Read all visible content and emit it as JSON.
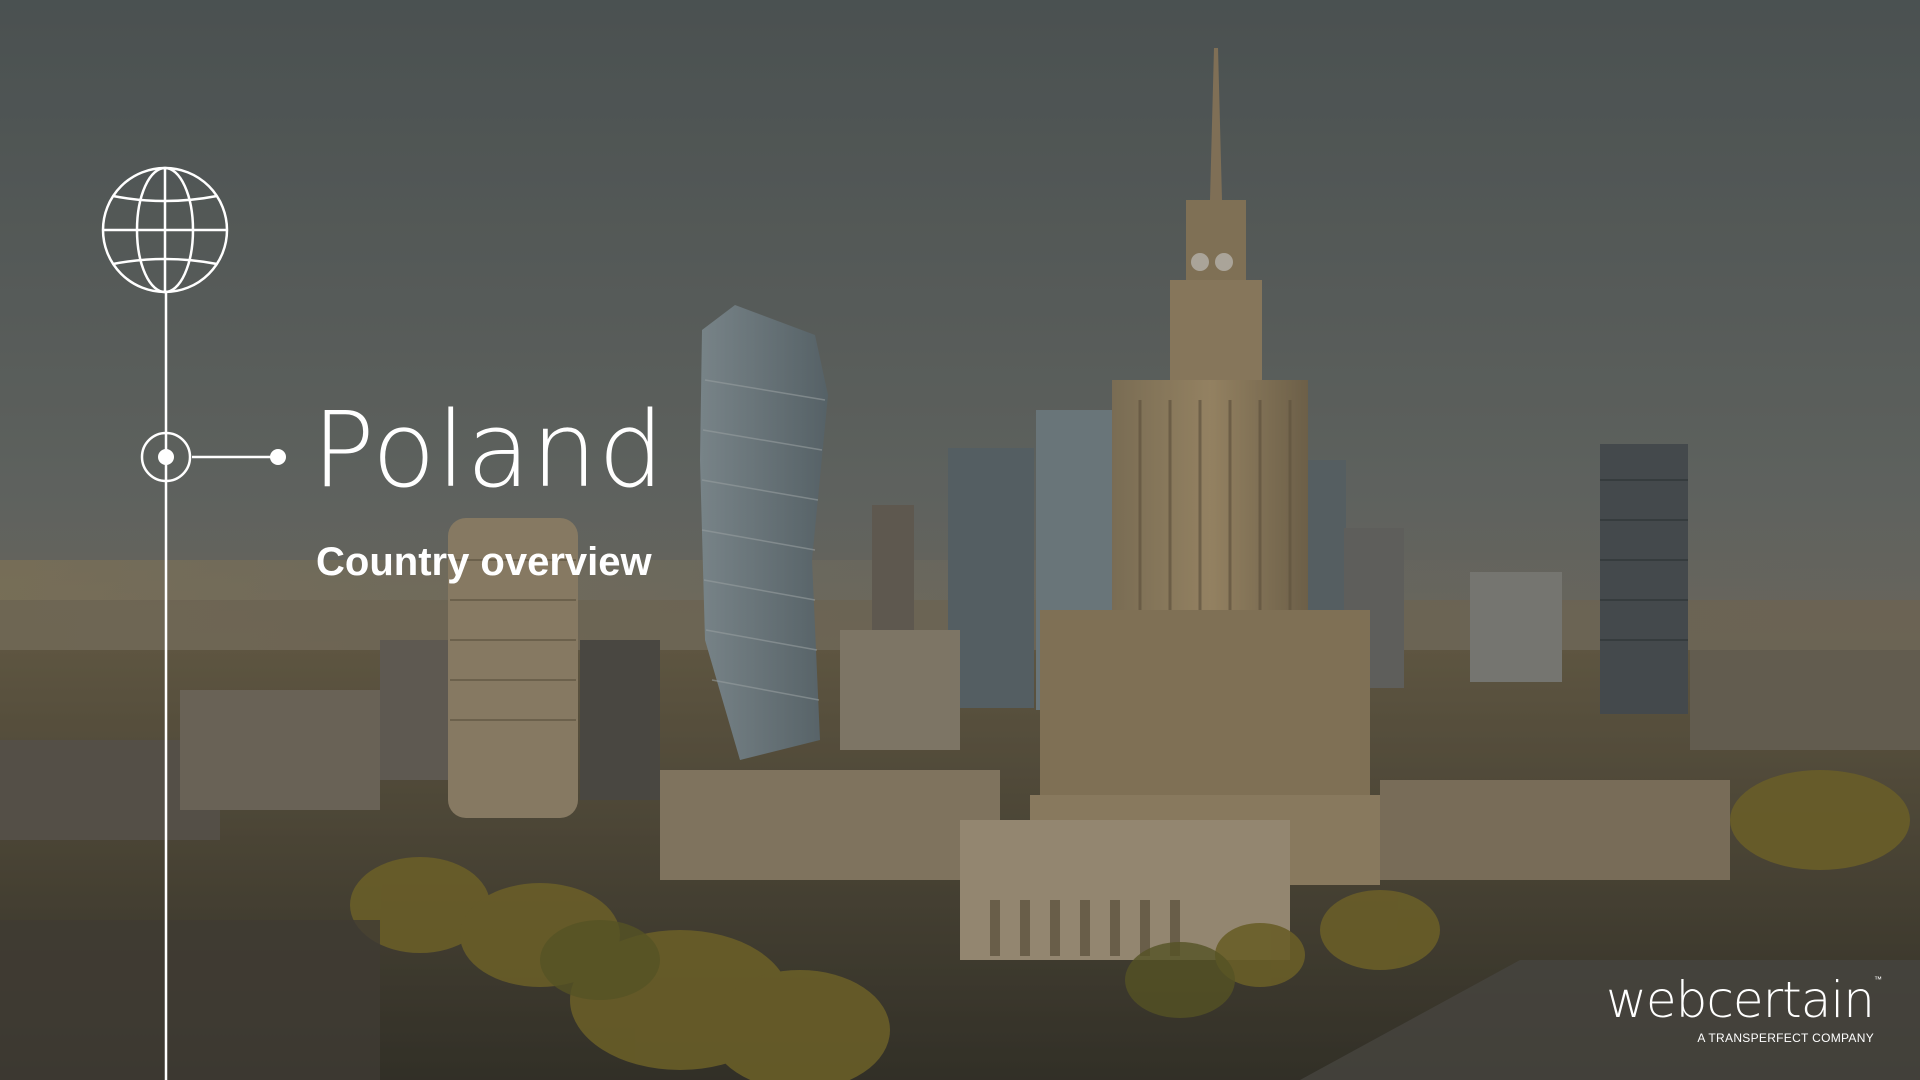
{
  "slide": {
    "title": "Poland",
    "subtitle": "Country overview"
  },
  "logo": {
    "wordmark": "webcertain",
    "trademark": "™",
    "tagline": "A TRANSPERFECT COMPANY"
  },
  "icons": {
    "globe": "globe-icon",
    "timeline_node": "target-node-icon"
  },
  "colors": {
    "text": "#ffffff",
    "sky": "#6f7878",
    "line": "#ffffff"
  }
}
